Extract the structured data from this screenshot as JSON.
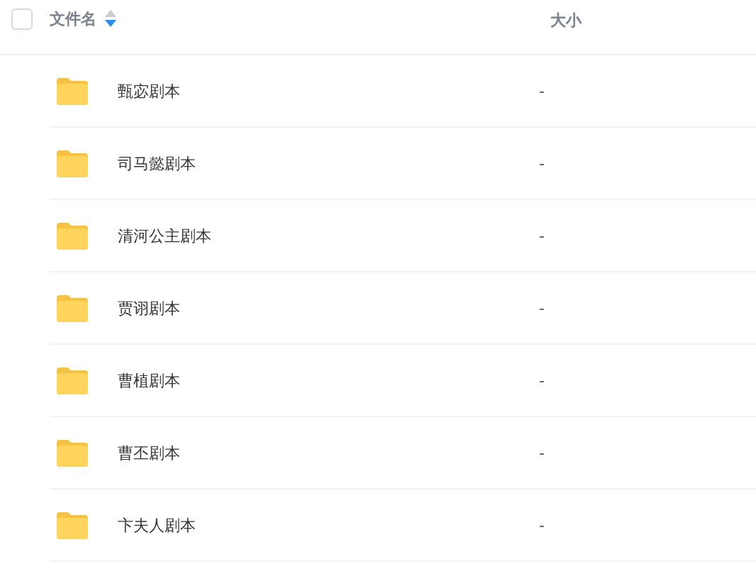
{
  "header": {
    "select_all": {
      "checked": false
    },
    "columns": [
      {
        "label": "文件名",
        "sort_descending": true
      },
      {
        "label": "大小"
      }
    ]
  },
  "rows": [
    {
      "name": "甄宓剧本",
      "size": "-"
    },
    {
      "name": "司马懿剧本",
      "size": "-"
    },
    {
      "name": "清河公主剧本",
      "size": "-"
    },
    {
      "name": "贾诩剧本",
      "size": "-"
    },
    {
      "name": "曹植剧本",
      "size": "-"
    },
    {
      "name": "曹丕剧本",
      "size": "-"
    },
    {
      "name": "卞夫人剧本",
      "size": "-"
    }
  ]
}
